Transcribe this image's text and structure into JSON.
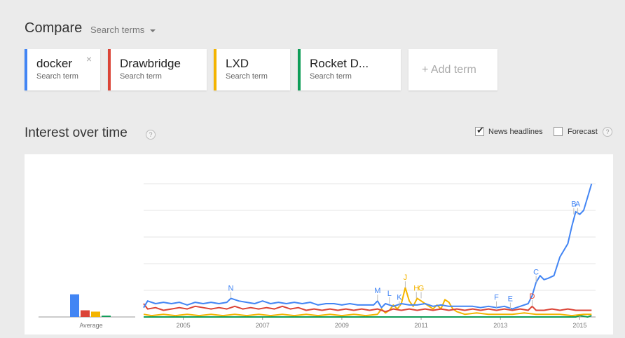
{
  "header": {
    "title": "Compare",
    "search_terms_label": "Search terms"
  },
  "terms": [
    {
      "term": "docker",
      "sub": "Search term",
      "color": "#4285f4",
      "closable": true
    },
    {
      "term": "Drawbridge",
      "sub": "Search term",
      "color": "#db4437",
      "closable": false
    },
    {
      "term": "LXD",
      "sub": "Search term",
      "color": "#f4b400",
      "closable": false
    },
    {
      "term": "Rocket D...",
      "sub": "Search term",
      "color": "#0f9d58",
      "closable": false
    }
  ],
  "add_term_label": "+ Add term",
  "interest": {
    "title": "Interest over time",
    "help_glyph": "?",
    "news_headlines": {
      "label": "News headlines",
      "checked": true
    },
    "forecast": {
      "label": "Forecast",
      "checked": false
    }
  },
  "chart_data": {
    "type": "line",
    "average_label": "Average",
    "averages": [
      {
        "name": "docker",
        "value": 17,
        "color": "#4285f4"
      },
      {
        "name": "Drawbridge",
        "value": 5,
        "color": "#db4437"
      },
      {
        "name": "LXD",
        "value": 4,
        "color": "#f4b400"
      },
      {
        "name": "Rocket D...",
        "value": 1,
        "color": "#0f9d58"
      }
    ],
    "x_range": [
      2004.0,
      2015.4
    ],
    "ylim": [
      0,
      100
    ],
    "x_ticks": [
      "2005",
      "2007",
      "2009",
      "2011",
      "2013",
      "2015"
    ],
    "x_tick_values": [
      2005,
      2007,
      2009,
      2011,
      2013,
      2015
    ],
    "series": [
      {
        "name": "docker",
        "color": "#4285f4",
        "points": [
          [
            2004.0,
            7
          ],
          [
            2004.1,
            12
          ],
          [
            2004.3,
            10
          ],
          [
            2004.5,
            11
          ],
          [
            2004.7,
            10
          ],
          [
            2004.9,
            11
          ],
          [
            2005.1,
            9
          ],
          [
            2005.3,
            11
          ],
          [
            2005.5,
            10
          ],
          [
            2005.7,
            11
          ],
          [
            2005.9,
            10
          ],
          [
            2006.1,
            11
          ],
          [
            2006.2,
            14
          ],
          [
            2006.4,
            12
          ],
          [
            2006.6,
            11
          ],
          [
            2006.8,
            10
          ],
          [
            2007.0,
            12
          ],
          [
            2007.2,
            10
          ],
          [
            2007.4,
            11
          ],
          [
            2007.6,
            10
          ],
          [
            2007.8,
            11
          ],
          [
            2008.0,
            10
          ],
          [
            2008.2,
            11
          ],
          [
            2008.4,
            9
          ],
          [
            2008.6,
            10
          ],
          [
            2008.8,
            10
          ],
          [
            2009.0,
            9
          ],
          [
            2009.2,
            10
          ],
          [
            2009.4,
            9
          ],
          [
            2009.6,
            9
          ],
          [
            2009.8,
            9
          ],
          [
            2009.9,
            12
          ],
          [
            2010.0,
            7
          ],
          [
            2010.1,
            10
          ],
          [
            2010.3,
            8
          ],
          [
            2010.5,
            10
          ],
          [
            2010.7,
            9
          ],
          [
            2010.9,
            9
          ],
          [
            2011.1,
            10
          ],
          [
            2011.3,
            8
          ],
          [
            2011.5,
            9
          ],
          [
            2011.7,
            8
          ],
          [
            2011.9,
            8
          ],
          [
            2012.1,
            8
          ],
          [
            2012.3,
            8
          ],
          [
            2012.5,
            7
          ],
          [
            2012.7,
            8
          ],
          [
            2012.9,
            7
          ],
          [
            2013.1,
            8
          ],
          [
            2013.3,
            6
          ],
          [
            2013.5,
            8
          ],
          [
            2013.7,
            10
          ],
          [
            2013.8,
            16
          ],
          [
            2013.9,
            26
          ],
          [
            2014.0,
            31
          ],
          [
            2014.1,
            28
          ],
          [
            2014.2,
            29
          ],
          [
            2014.35,
            31
          ],
          [
            2014.5,
            45
          ],
          [
            2014.7,
            55
          ],
          [
            2014.8,
            68
          ],
          [
            2014.9,
            79
          ],
          [
            2015.0,
            77
          ],
          [
            2015.1,
            80
          ],
          [
            2015.2,
            90
          ],
          [
            2015.3,
            100
          ]
        ]
      },
      {
        "name": "Drawbridge",
        "color": "#db4437",
        "points": [
          [
            2004.0,
            10
          ],
          [
            2004.1,
            6
          ],
          [
            2004.3,
            7
          ],
          [
            2004.5,
            5
          ],
          [
            2004.7,
            6
          ],
          [
            2004.9,
            7
          ],
          [
            2005.1,
            6
          ],
          [
            2005.3,
            8
          ],
          [
            2005.5,
            7
          ],
          [
            2005.7,
            6
          ],
          [
            2005.9,
            7
          ],
          [
            2006.1,
            6
          ],
          [
            2006.3,
            8
          ],
          [
            2006.5,
            6
          ],
          [
            2006.7,
            7
          ],
          [
            2006.9,
            6
          ],
          [
            2007.1,
            7
          ],
          [
            2007.3,
            6
          ],
          [
            2007.5,
            8
          ],
          [
            2007.7,
            6
          ],
          [
            2007.9,
            7
          ],
          [
            2008.1,
            5
          ],
          [
            2008.3,
            6
          ],
          [
            2008.5,
            5
          ],
          [
            2008.7,
            6
          ],
          [
            2008.9,
            5
          ],
          [
            2009.1,
            6
          ],
          [
            2009.3,
            5
          ],
          [
            2009.5,
            6
          ],
          [
            2009.7,
            5
          ],
          [
            2009.9,
            6
          ],
          [
            2010.1,
            4
          ],
          [
            2010.3,
            6
          ],
          [
            2010.5,
            5
          ],
          [
            2010.7,
            6
          ],
          [
            2010.9,
            5
          ],
          [
            2011.1,
            6
          ],
          [
            2011.3,
            5
          ],
          [
            2011.5,
            6
          ],
          [
            2011.7,
            5
          ],
          [
            2011.9,
            6
          ],
          [
            2012.1,
            5
          ],
          [
            2012.3,
            6
          ],
          [
            2012.5,
            5
          ],
          [
            2012.7,
            6
          ],
          [
            2012.9,
            5
          ],
          [
            2013.1,
            6
          ],
          [
            2013.3,
            5
          ],
          [
            2013.5,
            6
          ],
          [
            2013.7,
            5
          ],
          [
            2013.8,
            8
          ],
          [
            2013.9,
            5
          ],
          [
            2014.1,
            5
          ],
          [
            2014.3,
            6
          ],
          [
            2014.5,
            5
          ],
          [
            2014.7,
            6
          ],
          [
            2014.9,
            5
          ],
          [
            2015.1,
            5
          ],
          [
            2015.3,
            5
          ]
        ]
      },
      {
        "name": "LXD",
        "color": "#f4b400",
        "points": [
          [
            2004.0,
            2
          ],
          [
            2004.2,
            1
          ],
          [
            2004.5,
            2
          ],
          [
            2004.8,
            1
          ],
          [
            2005.1,
            2
          ],
          [
            2005.4,
            1
          ],
          [
            2005.7,
            2
          ],
          [
            2006.0,
            1
          ],
          [
            2006.3,
            2
          ],
          [
            2006.6,
            1
          ],
          [
            2006.9,
            2
          ],
          [
            2007.2,
            1
          ],
          [
            2007.5,
            2
          ],
          [
            2007.8,
            1
          ],
          [
            2008.1,
            2
          ],
          [
            2008.4,
            1
          ],
          [
            2008.7,
            2
          ],
          [
            2009.0,
            1
          ],
          [
            2009.3,
            2
          ],
          [
            2009.6,
            1
          ],
          [
            2009.9,
            2
          ],
          [
            2010.0,
            6
          ],
          [
            2010.1,
            3
          ],
          [
            2010.2,
            5
          ],
          [
            2010.3,
            9
          ],
          [
            2010.4,
            6
          ],
          [
            2010.5,
            10
          ],
          [
            2010.6,
            22
          ],
          [
            2010.7,
            12
          ],
          [
            2010.8,
            8
          ],
          [
            2010.9,
            14
          ],
          [
            2011.0,
            12
          ],
          [
            2011.1,
            10
          ],
          [
            2011.2,
            8
          ],
          [
            2011.3,
            6
          ],
          [
            2011.4,
            9
          ],
          [
            2011.5,
            6
          ],
          [
            2011.6,
            13
          ],
          [
            2011.7,
            11
          ],
          [
            2011.8,
            6
          ],
          [
            2011.9,
            4
          ],
          [
            2012.1,
            2
          ],
          [
            2012.4,
            3
          ],
          [
            2012.7,
            2
          ],
          [
            2013.0,
            2
          ],
          [
            2013.3,
            2
          ],
          [
            2013.6,
            3
          ],
          [
            2013.9,
            2
          ],
          [
            2014.2,
            2
          ],
          [
            2014.5,
            2
          ],
          [
            2014.8,
            1
          ],
          [
            2015.1,
            2
          ],
          [
            2015.3,
            2
          ]
        ]
      },
      {
        "name": "Rocket D...",
        "color": "#0f9d58",
        "points": [
          [
            2004.0,
            0
          ],
          [
            2005.0,
            0
          ],
          [
            2006.0,
            0
          ],
          [
            2007.0,
            0
          ],
          [
            2008.0,
            0
          ],
          [
            2009.0,
            0
          ],
          [
            2010.0,
            0
          ],
          [
            2011.0,
            0
          ],
          [
            2012.0,
            0
          ],
          [
            2013.0,
            0
          ],
          [
            2014.0,
            0
          ],
          [
            2014.9,
            0
          ],
          [
            2015.0,
            1
          ],
          [
            2015.2,
            0
          ],
          [
            2015.3,
            1
          ]
        ]
      }
    ],
    "annotations": [
      {
        "label": "N",
        "x": 2006.2,
        "y": 14,
        "color": "#4285f4"
      },
      {
        "label": "M",
        "x": 2009.9,
        "y": 12,
        "color": "#4285f4"
      },
      {
        "label": "L",
        "x": 2010.2,
        "y": 10,
        "color": "#4285f4"
      },
      {
        "label": "K",
        "x": 2010.45,
        "y": 7,
        "color": "#4285f4"
      },
      {
        "label": "J",
        "x": 2010.6,
        "y": 22,
        "color": "#f4b400"
      },
      {
        "label": "H",
        "x": 2010.88,
        "y": 14,
        "color": "#f4b400"
      },
      {
        "label": "G",
        "x": 2011.0,
        "y": 14,
        "color": "#f4b400"
      },
      {
        "label": "F",
        "x": 2012.9,
        "y": 7,
        "color": "#4285f4"
      },
      {
        "label": "E",
        "x": 2013.25,
        "y": 6,
        "color": "#4285f4"
      },
      {
        "label": "D",
        "x": 2013.8,
        "y": 8,
        "color": "#db4437"
      },
      {
        "label": "C",
        "x": 2013.9,
        "y": 26,
        "color": "#4285f4"
      },
      {
        "label": "B",
        "x": 2014.85,
        "y": 77,
        "color": "#4285f4"
      },
      {
        "label": "A",
        "x": 2014.95,
        "y": 77,
        "color": "#4285f4"
      }
    ]
  }
}
